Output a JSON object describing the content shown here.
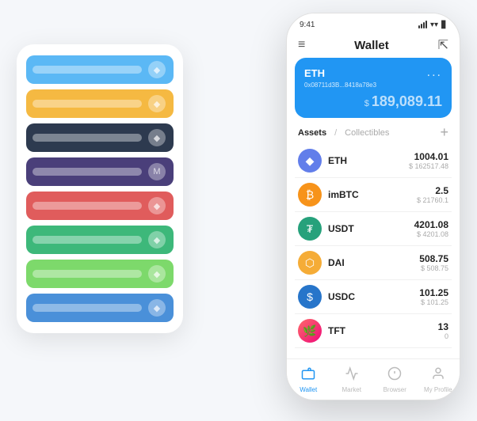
{
  "scene": {
    "background": "#f5f7fa"
  },
  "cardStack": {
    "items": [
      {
        "color": "#5bb8f5",
        "dotChar": "◆"
      },
      {
        "color": "#f5b942",
        "dotChar": "◆"
      },
      {
        "color": "#2d3a4f",
        "dotChar": "◆"
      },
      {
        "color": "#4a3f7a",
        "dotChar": "M"
      },
      {
        "color": "#e05c5c",
        "dotChar": "◆"
      },
      {
        "color": "#3db87a",
        "dotChar": "◆"
      },
      {
        "color": "#7dd96b",
        "dotChar": "◆"
      },
      {
        "color": "#4a90d9",
        "dotChar": "◆"
      }
    ]
  },
  "phone": {
    "statusBar": {
      "time": "9:41",
      "signal": "▌▌▌",
      "wifi": "wifi",
      "battery": "🔋"
    },
    "header": {
      "menuIcon": "≡",
      "title": "Wallet",
      "expandIcon": "⇱"
    },
    "ethCard": {
      "title": "ETH",
      "address": "0x08711d3B...8418a78e3",
      "addressSuffix": "⬡",
      "balanceLabel": "$",
      "balance": "189,089.11",
      "moreIcon": "..."
    },
    "assetsSection": {
      "tabActive": "Assets",
      "slash": "/",
      "tabInactive": "Collectibles",
      "addIcon": "+"
    },
    "assets": [
      {
        "symbol": "ETH",
        "name": "ETH",
        "iconBg": "#627eea",
        "iconChar": "◆",
        "amount": "1004.01",
        "value": "$ 162517.48"
      },
      {
        "symbol": "imBTC",
        "name": "imBTC",
        "iconBg": "#f7931a",
        "iconChar": "₿",
        "amount": "2.5",
        "value": "$ 21760.1"
      },
      {
        "symbol": "USDT",
        "name": "USDT",
        "iconBg": "#26a17b",
        "iconChar": "₮",
        "amount": "4201.08",
        "value": "$ 4201.08"
      },
      {
        "symbol": "DAI",
        "name": "DAI",
        "iconBg": "#f5ac37",
        "iconChar": "◈",
        "amount": "508.75",
        "value": "$ 508.75"
      },
      {
        "symbol": "USDC",
        "name": "USDC",
        "iconBg": "#2775ca",
        "iconChar": "$",
        "amount": "101.25",
        "value": "$ 101.25"
      },
      {
        "symbol": "TFT",
        "name": "TFT",
        "iconBg": "gradient",
        "iconChar": "T",
        "amount": "13",
        "value": "0"
      }
    ],
    "bottomNav": [
      {
        "label": "Wallet",
        "icon": "◎",
        "active": true
      },
      {
        "label": "Market",
        "icon": "📈",
        "active": false
      },
      {
        "label": "Browser",
        "icon": "👤",
        "active": false
      },
      {
        "label": "My Profile",
        "icon": "👤",
        "active": false
      }
    ]
  }
}
